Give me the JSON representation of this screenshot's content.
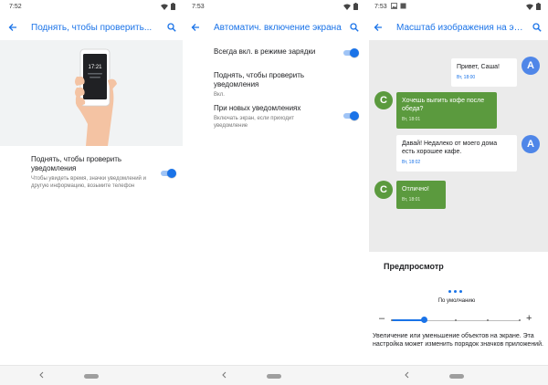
{
  "screens": [
    {
      "status_time": "7:52",
      "title": "Поднять, чтобы проверить...",
      "setting": {
        "title": "Поднять, чтобы проверить уведомления",
        "subtitle": "Чтобы увидеть время, значки уведомлений и другую информацию, возьмите телефон",
        "enabled": true
      },
      "illustration_time": "17:21"
    },
    {
      "status_time": "7:53",
      "title": "Автоматич. включение экрана",
      "items": [
        {
          "title": "Всегда вкл. в режиме зарядки",
          "subtitle": "",
          "enabled": true
        },
        {
          "title": "Поднять, чтобы проверить уведомления",
          "subtitle": "Вкл."
        },
        {
          "title": "При новых уведомлениях",
          "subtitle": "Включать экран, если приходит уведомление",
          "enabled": true
        }
      ]
    },
    {
      "status_time": "7:53",
      "title": "Масштаб изображения на экране",
      "messages": [
        {
          "from": "A",
          "text": "Привет, Саша!",
          "meta": "Вт, 18:00"
        },
        {
          "from": "C",
          "text": "Хочешь выпить кофе после обеда?",
          "meta": "Вт, 18:01"
        },
        {
          "from": "A",
          "text": "Давай! Недалеко от моего дома есть хорошее кафе.",
          "meta": "Вт, 18:02"
        },
        {
          "from": "C",
          "text": "Отлично!",
          "meta": "Вт, 18:01"
        }
      ],
      "preview_label": "Предпросмотр",
      "scale_label": "По умолчанию",
      "scale_level": 1,
      "scale_levels": 5,
      "description": "Увеличение или уменьшение объектов на экране. Эта настройка может изменить порядок значков приложений."
    }
  ],
  "colors": {
    "accent": "#1a73e8",
    "toggle_track": "#9fc4f6",
    "avatar_a": "#4f86e8",
    "bubble_green": "#5b9a3e",
    "chat_bg": "#ebebeb"
  },
  "icons": {
    "back": "arrow-left-icon",
    "search": "search-icon",
    "wifi": "wifi-icon",
    "battery": "battery-icon",
    "nav_back": "chevron-left-icon",
    "home": "home-pill-icon"
  }
}
